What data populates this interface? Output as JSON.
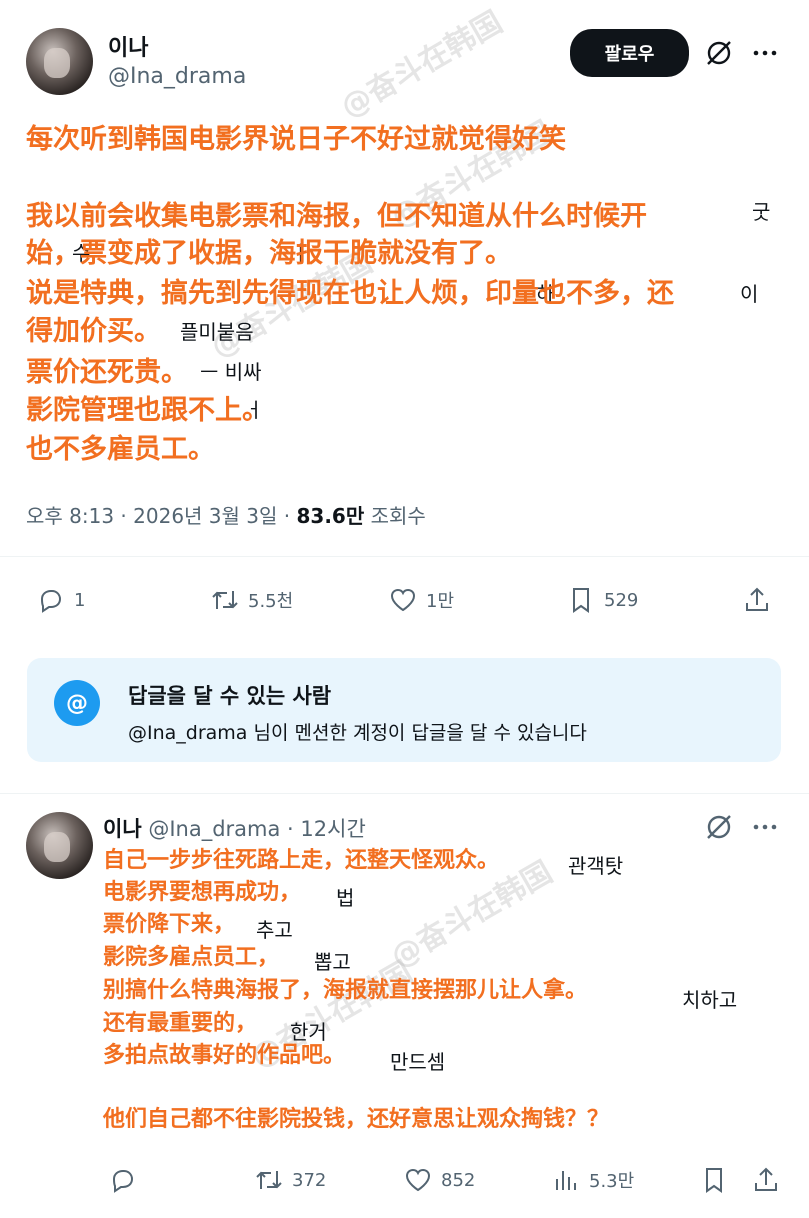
{
  "tweet": {
    "author_name": "이나",
    "author_handle": "@Ina_drama",
    "follow_label": "팔로우",
    "lines": [
      "每次听到韩国电影界说日子不好过就觉得好笑",
      "",
      "我以前会收集电影票和海报，但不知道从什么时候开",
      "始，票变成了收据，海报干脆就没有了。",
      "说是特典，搞先到先得现在也让人烦，印量也不多，还",
      "得加价买。",
      "票价还死贵。",
      "影院管理也跟不上。",
      "也不多雇员工。"
    ],
    "ghost_text": [
      "굿",
      "수",
      "ㅏ",
      "하",
      "이",
      "플미붙음",
      "ㅡ 비싸",
      "ㅓ"
    ],
    "time": "오후 8:13",
    "date": "2026년 3월 3일",
    "views_count": "83.6만",
    "views_label": "조회수",
    "stats": {
      "replies": "1",
      "retweets": "5.5천",
      "likes": "1만",
      "bookmarks": "529"
    }
  },
  "reply_permission": {
    "title": "답글을 달 수 있는 사람",
    "description": "@Ina_drama 님이 멘션한 계정이 답글을 달 수 있습니다",
    "icon_text": "@"
  },
  "reply": {
    "author_name": "이나",
    "author_handle": "@Ina_drama",
    "time_ago": "· 12시간",
    "lines": [
      "自己一步步往死路上走，还整天怪观众。",
      "电影界要想再成功，",
      "票价降下来，",
      "影院多雇点员工，",
      "别搞什么特典海报了，海报就直接摆那儿让人拿。",
      "还有最重要的，",
      "多拍点故事好的作品吧。",
      "",
      "他们自己都不往影院投钱，还好意思让观众掏钱？？"
    ],
    "ghost_text": [
      "관객탓",
      "법",
      "추고",
      "뽑고",
      "치하고",
      "한거",
      "만드셈"
    ],
    "stats": {
      "replies": "",
      "retweets": "372",
      "likes": "852",
      "views": "5.3만"
    }
  },
  "watermark": "@奋斗在韩国",
  "colors": {
    "overlay_text": "#f26f20",
    "accent": "#1d9bf0"
  }
}
